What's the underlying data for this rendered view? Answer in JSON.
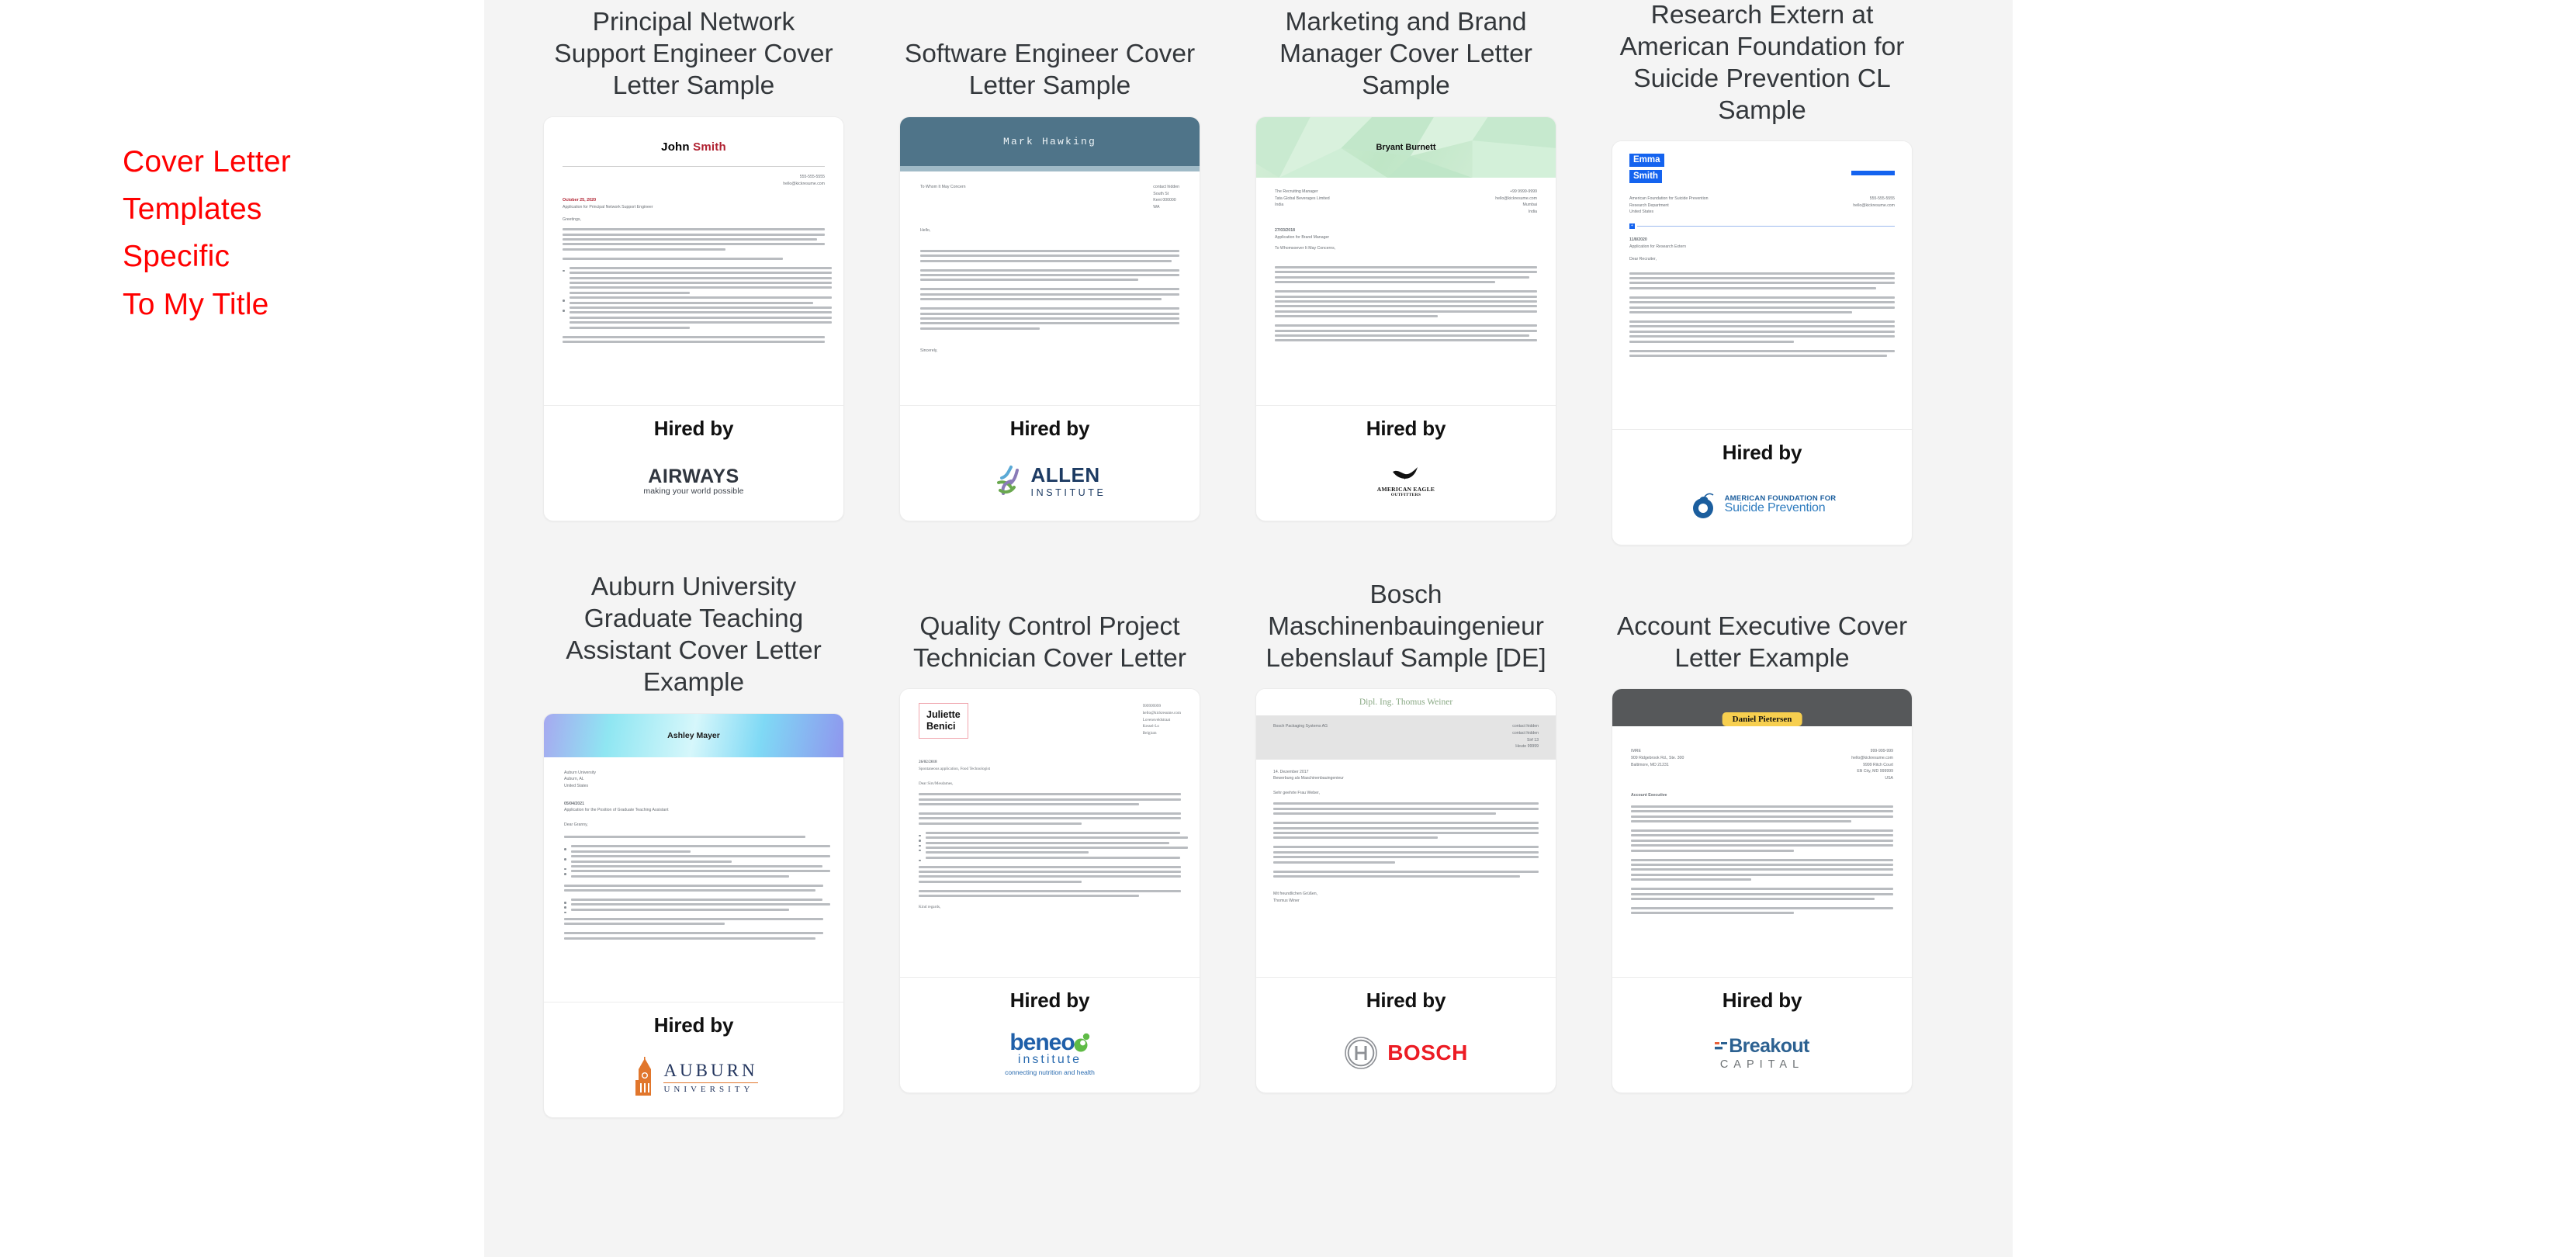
{
  "heading": {
    "lines": [
      "Cover Letter",
      "Templates",
      "Specific",
      "To My Title"
    ],
    "color": "#FF0000"
  },
  "hired_by_label": "Hired by",
  "cards": [
    {
      "title": "Principal Network Support Engineer Cover Letter Sample",
      "applicant_name": "John Smith",
      "applicant_first": "John",
      "applicant_last": "Smith",
      "doc_contact": [
        "555-555-5555",
        "hello@kickresume.com"
      ],
      "doc_date": "October 25, 2020",
      "doc_subject": "Application for Principal Network Support Engineer",
      "doc_salutation": "Greetings,",
      "company": "AIRWAYS",
      "company_tagline": "making your world possible",
      "accent": "#b02030"
    },
    {
      "title": "Software Engineer Cover Letter Sample",
      "applicant_name": "Mark Hawking",
      "doc_recipient": "To Whom It May Concern",
      "doc_contact": [
        "contact hidden",
        "South St",
        "Kent 000000",
        "WA"
      ],
      "doc_salutation": "Hello,",
      "doc_closing": "Sincerely,",
      "company": "ALLEN",
      "company_sub": "INSTITUTE",
      "accent": "#4f7489"
    },
    {
      "title": "Marketing and Brand Manager Cover Letter Sample",
      "applicant_name": "Bryant Burnett",
      "doc_recipient": [
        "The Recruiting Manager",
        "Tata Global Beverages Limited",
        "India"
      ],
      "doc_contact": [
        "+99 9999-9999",
        "hello@kickresume.com",
        "Mumbai",
        "India"
      ],
      "doc_date": "27/03/2018",
      "doc_subject": "Application for Brand Manager",
      "doc_salutation": "To Whomsoever It May Concerns,",
      "company": "AMERICAN EAGLE",
      "company_sub": "OUTFITTERS",
      "accent": "#bfe6c6"
    },
    {
      "title": "Research Extern at American Foundation for Suicide Prevention CL Sample",
      "applicant_name": "Emma Smith",
      "applicant_first": "Emma",
      "applicant_last": "Smith",
      "doc_recipient": [
        "American Foundation for Suicide Prevention",
        "Research Department",
        "United States"
      ],
      "doc_contact": [
        "555-555-5555",
        "hello@kickresume.com"
      ],
      "doc_date": "11/8/2020",
      "doc_subject": "Application for Research Extern",
      "doc_salutation": "Dear Recruiter,",
      "company": "AMERICAN FOUNDATION FOR",
      "company_sub": "Suicide Prevention",
      "accent": "#1463ef"
    },
    {
      "title": "Auburn University Graduate Teaching Assistant Cover Letter Example",
      "applicant_name": "Ashley Mayer",
      "doc_subject": "Application for the Position of Graduate Teaching Assistant",
      "doc_salutation": "Dear Granny,",
      "company": "AUBURN",
      "company_sub": "UNIVERSITY",
      "accent": "#8fe6f2"
    },
    {
      "title": "Quality Control Project Technician Cover Letter",
      "applicant_name": "Juliette Benici",
      "applicant_first": "Juliette",
      "applicant_last": "Benici",
      "doc_contact": [
        "999999999",
        "hello@kickresume.com",
        "Lovensveldstraat",
        "Kessel-Lo",
        "Belgium"
      ],
      "doc_date": "26/02/2018",
      "doc_subject": "Spontaneous application, Food Technologist",
      "doc_closing": "Kind regards,",
      "company": "beneo",
      "company_sub": "institute",
      "company_tagline": "connecting nutrition and health",
      "accent": "#f0a6ae"
    },
    {
      "title": "Bosch Maschinenbauingenieur Lebenslauf Sample [DE]",
      "applicant_name": "Dipl. Ing. Thomus Weiner",
      "doc_recipient": [
        "Bosch Packaging Systems AG"
      ],
      "doc_contact": [
        "contact hidden",
        "contact hidden",
        "Sirf 13",
        "Heute 99999"
      ],
      "doc_closing": "Thomus Winer",
      "company": "BOSCH",
      "accent": "#8aa985"
    },
    {
      "title": "Account Executive Cover Letter Example",
      "applicant_name": "Daniel Pietersen",
      "doc_recipient": [
        "IMRE",
        "909 Ridgebrook Rd., Ste. 300",
        "Baltimore, MD 21231"
      ],
      "doc_contact": [
        "999-999-999",
        "hello@kickresume.com",
        "9999 Ritch Court",
        "Elli City, MD 999999",
        "USA"
      ],
      "company": "Breakout",
      "company_sub": "CAPITAL",
      "accent": "#f7cf4f"
    }
  ]
}
